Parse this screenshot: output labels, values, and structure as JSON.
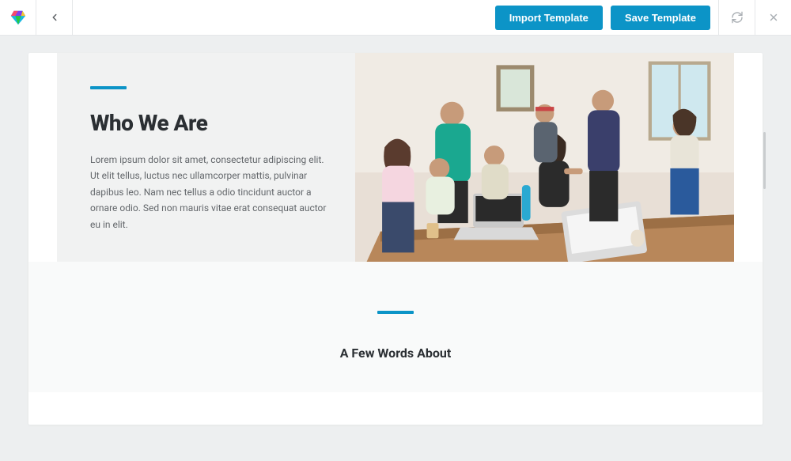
{
  "topbar": {
    "import_label": "Import Template",
    "save_label": "Save Template"
  },
  "hero": {
    "title": "Who We Are",
    "body": "Lorem ipsum dolor sit amet, consectetur adipiscing elit. Ut elit tellus, luctus nec ullamcorper mattis, pulvinar dapibus leo. Nam nec tellus a odio tincidunt auctor a ornare odio. Sed non mauris vitae erat consequat auctor eu in elit."
  },
  "section2": {
    "title": "A Few Words About"
  }
}
